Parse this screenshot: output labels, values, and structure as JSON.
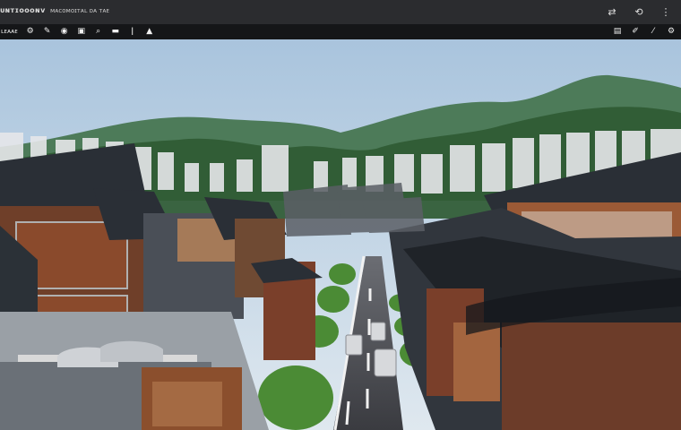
{
  "window": {
    "title": "ᴜɴᴛɪᴏᴏᴏɴᴠ",
    "subtitle": "ᴍᴀᴄᴏᴍᴏɪᴛᴀʟ ᴅᴀ ᴛᴀᴇ",
    "controls": [
      {
        "name": "swap-icon",
        "glyph": "⇄"
      },
      {
        "name": "fit-icon",
        "glyph": "⟲"
      },
      {
        "name": "more-icon",
        "glyph": "⋮"
      }
    ]
  },
  "toolbar": {
    "left_label": "ʟᴇᴀᴀᴇ",
    "left_items": [
      {
        "name": "gear-icon",
        "glyph": "⚙"
      },
      {
        "name": "pen-icon",
        "glyph": "✎"
      },
      {
        "name": "eye-icon",
        "glyph": "◉"
      },
      {
        "name": "image-icon",
        "glyph": "▣"
      },
      {
        "name": "search-icon",
        "glyph": "⌕"
      },
      {
        "name": "layer-icon",
        "glyph": "▬"
      },
      {
        "name": "pipe-icon",
        "glyph": "ǀ"
      },
      {
        "name": "triangle-icon",
        "glyph": "▲"
      }
    ],
    "right_items": [
      {
        "name": "grid-icon",
        "glyph": "▤"
      },
      {
        "name": "brush-icon",
        "glyph": "✐"
      },
      {
        "name": "tip-icon",
        "glyph": "⁄"
      },
      {
        "name": "settings-icon",
        "glyph": "⚙"
      }
    ]
  },
  "scene": {
    "sky_top": "#a9c4dd",
    "sky_bottom": "#d7e3ee",
    "mountain_near": "#2f5a33",
    "mountain_far": "#4d7b59",
    "roof": "#2a2f36",
    "wall": "#8a4a2c",
    "road": "#4a4b50",
    "tree": "#4b8b35"
  }
}
